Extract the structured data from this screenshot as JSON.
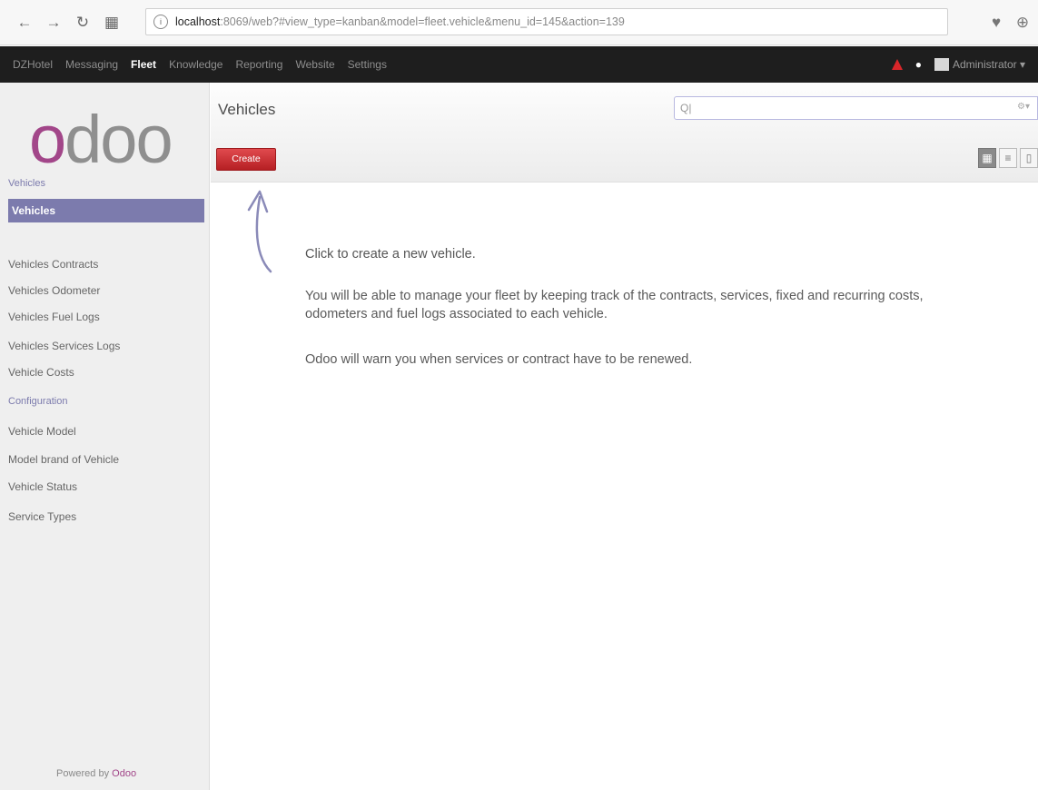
{
  "browser": {
    "url_host": "localhost",
    "url_rest": ":8069/web?#view_type=kanban&model=fleet.vehicle&menu_id=145&action=139"
  },
  "topnav": {
    "items": [
      "DZHotel",
      "Messaging",
      "Fleet",
      "Knowledge",
      "Reporting",
      "Website",
      "Settings"
    ],
    "active": "Fleet",
    "user": "Administrator ▾"
  },
  "sidebar": {
    "logo_first": "o",
    "logo_rest": "doo",
    "vehicles_heading": "Vehicles",
    "vehicles_items": [
      "Vehicles",
      "Vehicles Contracts",
      "Vehicles Odometer",
      "Vehicles Fuel Logs",
      "Vehicles Services Logs",
      "Vehicle Costs"
    ],
    "config_heading": "Configuration",
    "config_items": [
      "Vehicle Model",
      "Model brand of Vehicle",
      "Vehicle Status",
      "Service Types"
    ],
    "powered_prefix": "Powered by ",
    "powered_brand": "Odoo"
  },
  "main": {
    "title": "Vehicles",
    "create_label": "Create",
    "search_placeholder": "Q|",
    "help_lead": "Click to create a new vehicle.",
    "help_p1": "You will be able to manage your fleet by keeping track of the contracts, services, fixed and recurring costs, odometers and fuel logs associated to each vehicle.",
    "help_p2": "Odoo will warn you when services or contract have to be renewed."
  },
  "colors": {
    "brand_purple": "#7c7bad",
    "logo_pink": "#a24689",
    "create_red": "#c9282c"
  }
}
